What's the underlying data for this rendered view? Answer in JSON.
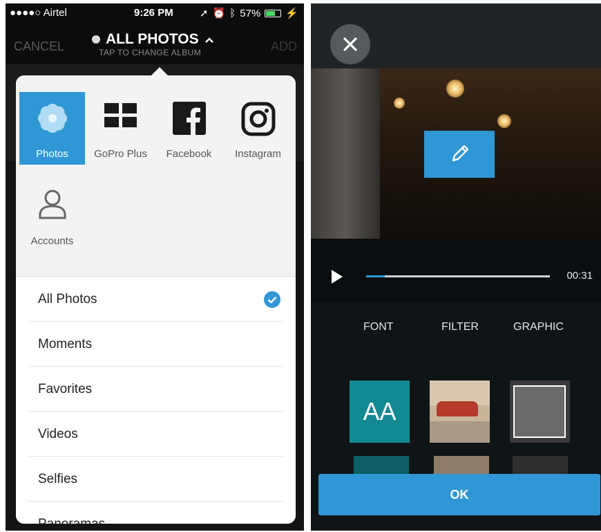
{
  "left": {
    "status": {
      "carrier": "●●●●○ Airtel",
      "time": "9:26 PM",
      "battery": "57%"
    },
    "nav": {
      "cancel": "CANCEL",
      "title": "ALL PHOTOS",
      "subtitle": "TAP TO CHANGE ALBUM",
      "add": "ADD"
    },
    "sources": [
      {
        "label": "Photos",
        "icon": "flower-icon",
        "active": true
      },
      {
        "label": "GoPro Plus",
        "icon": "grid-icon",
        "active": false
      },
      {
        "label": "Facebook",
        "icon": "facebook-icon",
        "active": false
      },
      {
        "label": "Instagram",
        "icon": "instagram-icon",
        "active": false
      },
      {
        "label": "Accounts",
        "icon": "person-icon",
        "active": false
      }
    ],
    "albums": [
      {
        "label": "All Photos",
        "selected": true
      },
      {
        "label": "Moments",
        "selected": false
      },
      {
        "label": "Favorites",
        "selected": false
      },
      {
        "label": "Videos",
        "selected": false
      },
      {
        "label": "Selfies",
        "selected": false
      },
      {
        "label": "Panoramas",
        "selected": false
      }
    ]
  },
  "right": {
    "duration": "00:31",
    "playback_progress": 0.1,
    "tabs": [
      "FONT",
      "FILTER",
      "GRAPHIC"
    ],
    "font_tile": "AA",
    "ok": "OK"
  },
  "colors": {
    "accent": "#2f97d5",
    "teal": "#138a93"
  }
}
